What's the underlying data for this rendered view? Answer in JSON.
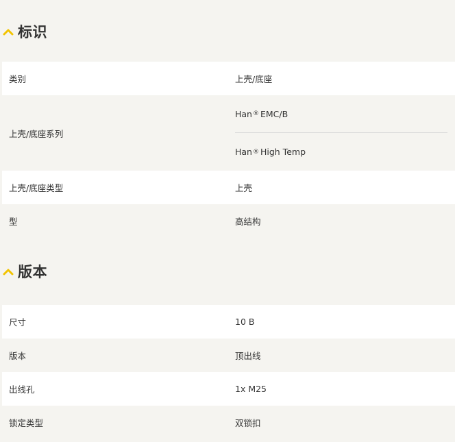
{
  "sections": [
    {
      "title": "标识",
      "rows": [
        {
          "label": "类别",
          "value": "上壳/底座"
        },
        {
          "label": "上壳/底座系列",
          "values": [
            {
              "prefix": "Han",
              "mark": "®",
              "suffix": "EMC/B"
            },
            {
              "prefix": "Han",
              "mark": "®",
              "suffix": "High Temp"
            }
          ]
        },
        {
          "label": "上壳/底座类型",
          "value": "上壳"
        },
        {
          "label": "型",
          "value": "高结构"
        }
      ]
    },
    {
      "title": "版本",
      "rows": [
        {
          "label": "尺寸",
          "value": "10 B"
        },
        {
          "label": "版本",
          "value": "顶出线"
        },
        {
          "label": "出线孔",
          "value": "1x M25"
        },
        {
          "label": "锁定类型",
          "value": "双锁扣"
        }
      ]
    }
  ],
  "colors": {
    "accent": "#f2c300",
    "background": "#f5f4f0",
    "row_white": "#ffffff",
    "text": "#333333"
  },
  "icons": {
    "section_toggle": "chevron-up-icon"
  }
}
